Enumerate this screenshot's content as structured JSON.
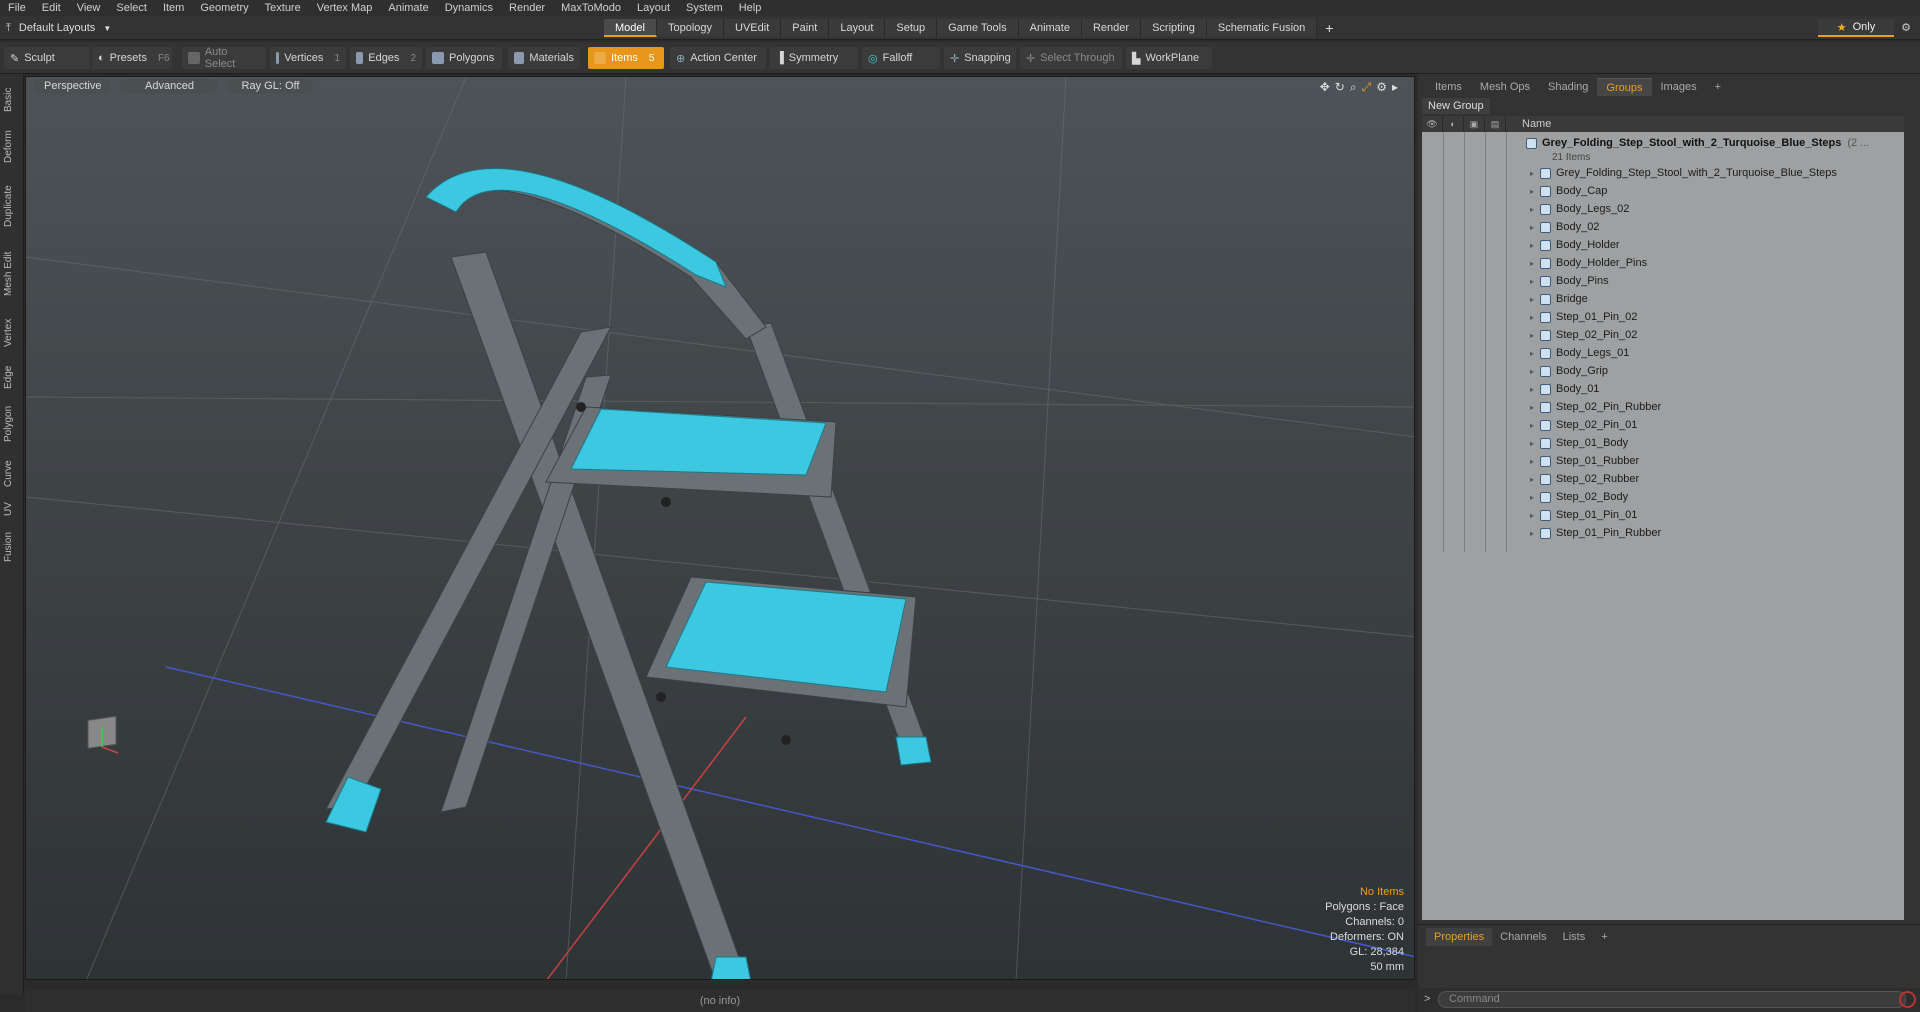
{
  "menu": [
    "File",
    "Edit",
    "View",
    "Select",
    "Item",
    "Geometry",
    "Texture",
    "Vertex Map",
    "Animate",
    "Dynamics",
    "Render",
    "MaxToModo",
    "Layout",
    "System",
    "Help"
  ],
  "layout": {
    "label": "Default Layouts",
    "mode_tabs": [
      "Model",
      "Topology",
      "UVEdit",
      "Paint",
      "Layout",
      "Setup",
      "Game Tools",
      "Animate",
      "Render",
      "Scripting",
      "Schematic Fusion"
    ],
    "active_tab": "Model",
    "only_label": "Only"
  },
  "toolbar": {
    "sculpt": "Sculpt",
    "presets": "Presets",
    "presets_key": "F6",
    "auto_select": "Auto Select",
    "vertices": "Vertices",
    "vertices_key": "1",
    "edges": "Edges",
    "edges_key": "2",
    "polygons": "Polygons",
    "materials": "Materials",
    "items": "Items",
    "items_key": "5",
    "action_center": "Action Center",
    "symmetry": "Symmetry",
    "falloff": "Falloff",
    "snapping": "Snapping",
    "select_through": "Select Through",
    "workplane": "WorkPlane"
  },
  "left_tabs": [
    "Basic",
    "Deform",
    "Duplicate",
    "Mesh Edit",
    "Vertex",
    "Edge",
    "Polygon",
    "Curve",
    "UV",
    "Fusion"
  ],
  "viewport": {
    "perspective": "Perspective",
    "advanced": "Advanced",
    "raygl": "Ray GL: Off",
    "info_no_items": "No Items",
    "info_polygons": "Polygons : Face",
    "info_channels": "Channels: 0",
    "info_deformers": "Deformers: ON",
    "info_gl": "GL: 28,384",
    "info_scale": "50 mm",
    "status": "(no info)"
  },
  "right_panel": {
    "tabs": [
      "Items",
      "Mesh Ops",
      "Shading",
      "Groups",
      "Images"
    ],
    "active_tab": "Groups",
    "new_group": "New Group",
    "name_header": "Name",
    "group_name": "Grey_Folding_Step_Stool_with_2_Turquoise_Blue_Steps",
    "group_suffix": "(2 ...",
    "group_count": "21 Items",
    "items": [
      "Grey_Folding_Step_Stool_with_2_Turquoise_Blue_Steps",
      "Body_Cap",
      "Body_Legs_02",
      "Body_02",
      "Body_Holder",
      "Body_Holder_Pins",
      "Body_Pins",
      "Bridge",
      "Step_01_Pin_02",
      "Step_02_Pin_02",
      "Body_Legs_01",
      "Body_Grip",
      "Body_01",
      "Step_02_Pin_Rubber",
      "Step_02_Pin_01",
      "Step_01_Body",
      "Step_01_Rubber",
      "Step_02_Rubber",
      "Step_02_Body",
      "Step_01_Pin_01",
      "Step_01_Pin_Rubber"
    ]
  },
  "bottom_panel": {
    "tabs": [
      "Properties",
      "Channels",
      "Lists"
    ],
    "active_tab": "Properties",
    "command_placeholder": "Command",
    "prompt": ">"
  },
  "colors": {
    "accent": "#e8951c",
    "turquoise": "#3cc8e0",
    "stool_grey": "#6a7276"
  }
}
